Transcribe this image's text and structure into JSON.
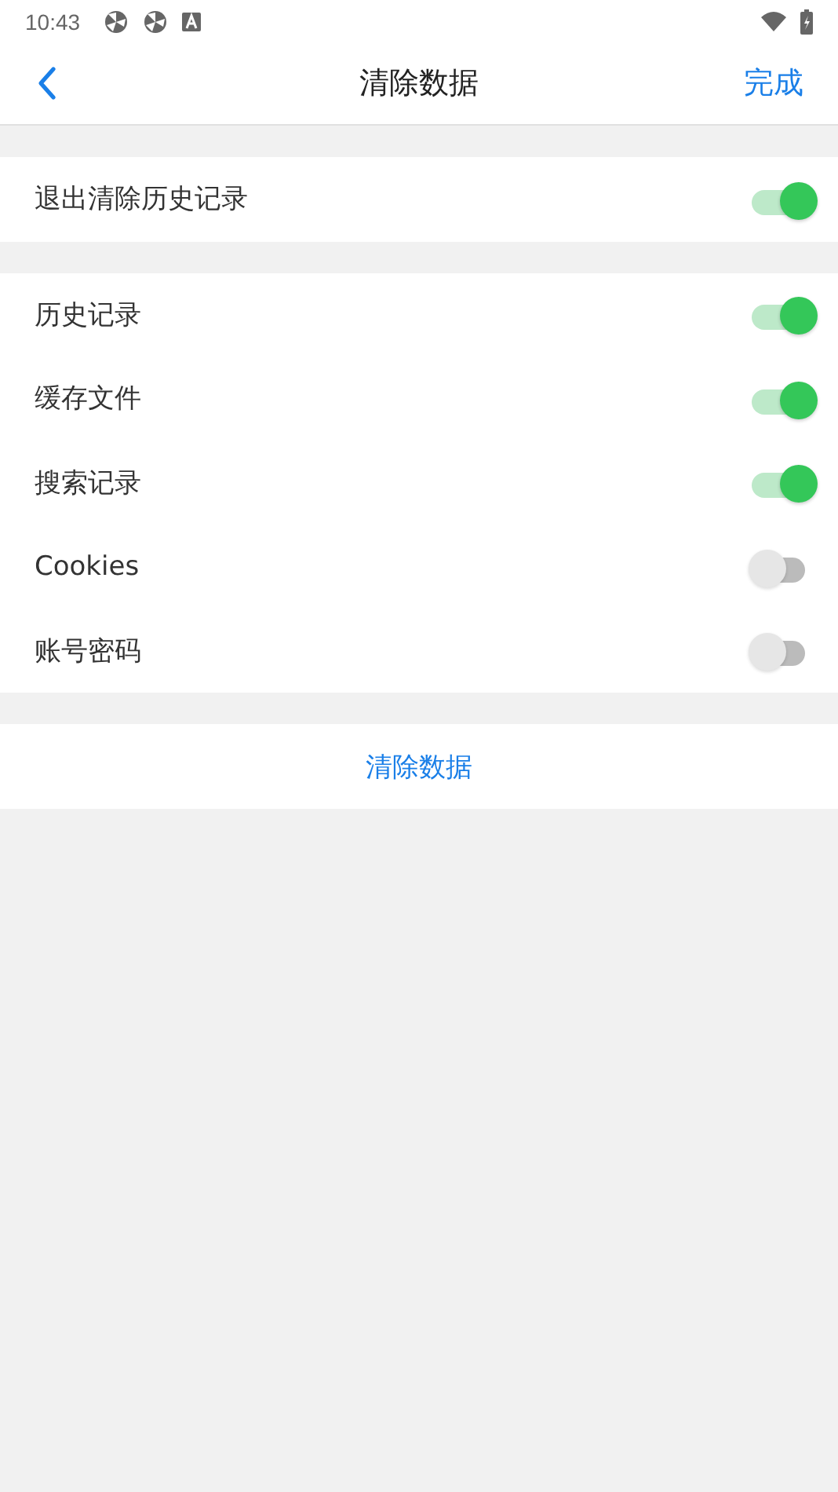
{
  "status_bar": {
    "time": "10:43"
  },
  "nav": {
    "title": "清除数据",
    "action": "完成"
  },
  "sections": [
    {
      "rows": [
        {
          "label": "退出清除历史记录",
          "on": true
        }
      ]
    },
    {
      "rows": [
        {
          "label": "历史记录",
          "on": true
        },
        {
          "label": "缓存文件",
          "on": true
        },
        {
          "label": "搜索记录",
          "on": true
        },
        {
          "label": "Cookies",
          "on": false
        },
        {
          "label": "账号密码",
          "on": false
        }
      ]
    }
  ],
  "clear_button": "清除数据"
}
